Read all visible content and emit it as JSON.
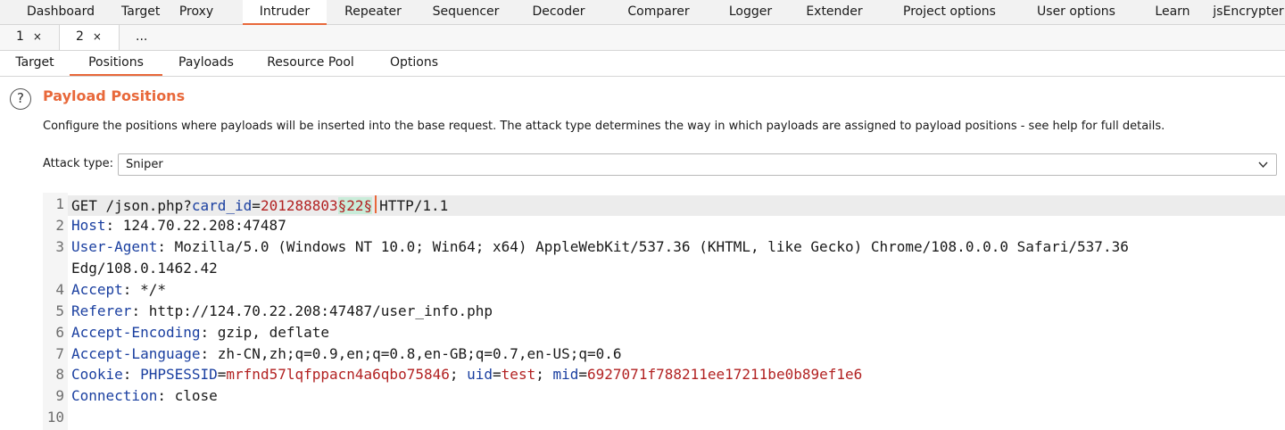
{
  "top_tabs": [
    {
      "label": "Dashboard",
      "active": false
    },
    {
      "label": "Target",
      "active": false
    },
    {
      "label": "Proxy",
      "active": false
    },
    {
      "label": "Intruder",
      "active": true
    },
    {
      "label": "Repeater",
      "active": false
    },
    {
      "label": "Sequencer",
      "active": false
    },
    {
      "label": "Decoder",
      "active": false
    },
    {
      "label": "Comparer",
      "active": false
    },
    {
      "label": "Logger",
      "active": false
    },
    {
      "label": "Extender",
      "active": false
    },
    {
      "label": "Project options",
      "active": false
    },
    {
      "label": "User options",
      "active": false
    },
    {
      "label": "Learn",
      "active": false
    },
    {
      "label": "jsEncrypter",
      "active": false
    }
  ],
  "attack_tabs": [
    {
      "label": "1",
      "close": "×"
    },
    {
      "label": "2",
      "close": "×"
    },
    {
      "label": "..."
    }
  ],
  "intruder_tabs": [
    {
      "label": "Target"
    },
    {
      "label": "Positions"
    },
    {
      "label": "Payloads"
    },
    {
      "label": "Resource Pool"
    },
    {
      "label": "Options"
    }
  ],
  "section": {
    "help_glyph": "?",
    "title": "Payload Positions",
    "description": "Configure the positions where payloads will be inserted into the base request. The attack type determines the way in which payloads are assigned to payload positions - see help for full details."
  },
  "attack_type": {
    "label": "Attack type:",
    "value": "Sniper"
  },
  "request": {
    "line_numbers": [
      "1",
      "2",
      "3",
      "4",
      "5",
      "6",
      "7",
      "8",
      "9",
      "10"
    ],
    "l1": {
      "method": "GET /json.php?",
      "param": "card_id",
      "eq": "=",
      "value": "201288803",
      "payload": "§22§",
      "rest": "HTTP/1.1"
    },
    "l2": {
      "key": "Host",
      "rest": ": 124.70.22.208:47487"
    },
    "l3": {
      "key": "User-Agent",
      "rest": ": Mozilla/5.0 (Windows NT 10.0; Win64; x64) AppleWebKit/537.36 (KHTML, like Gecko) Chrome/108.0.0.0 Safari/537.36"
    },
    "l3b": "Edg/108.0.1462.42",
    "l4": {
      "key": "Accept",
      "rest": ": */*"
    },
    "l5": {
      "key": "Referer",
      "rest": ": http://124.70.22.208:47487/user_info.php"
    },
    "l6": {
      "key": "Accept-Encoding",
      "rest": ": gzip, deflate"
    },
    "l7": {
      "key": "Accept-Language",
      "rest": ": zh-CN,zh;q=0.9,en;q=0.8,en-GB;q=0.7,en-US;q=0.6"
    },
    "l8": {
      "key": "Cookie",
      "sep": ": ",
      "c1k": "PHPSESSID",
      "c1v": "mrfnd57lqfppacn4a6qbo75846",
      "semi1": "; ",
      "c2k": "uid",
      "c2v": "test",
      "semi2": "; ",
      "c3k": "mid",
      "c3v": "6927071f788211ee17211be0b89ef1e6",
      "eq": "="
    },
    "l9": {
      "key": "Connection",
      "rest": ": close"
    }
  },
  "colors": {
    "accent": "#e8683a",
    "key": "#1a3fa0",
    "value": "#b22222",
    "payload_bg": "#c9ecd9"
  }
}
